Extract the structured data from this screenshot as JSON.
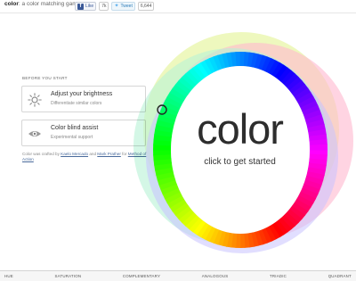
{
  "header": {
    "brand_name": "color",
    "brand_tagline": ": a color matching game",
    "fb_like": "Like",
    "fb_count": "7k",
    "tweet": "Tweet",
    "tweet_count": "6,644"
  },
  "intro": {
    "heading": "BEFORE YOU START",
    "brightness_title": "Adjust your brightness",
    "brightness_sub": "Differentiate similar colors",
    "colorblind_title": "Color blind assist",
    "colorblind_sub": "Experimental support",
    "credits_prefix": "Color was crafted by",
    "credit_one": "Kaelo Mercado",
    "credits_and": "and",
    "credit_two": "Mark Prather",
    "credits_for": "for",
    "credit_three": "Method of Action"
  },
  "wheel": {
    "title": "color",
    "subtitle": "click to get started",
    "accent": "#ffffff"
  },
  "modes": [
    "HUE",
    "SATURATION",
    "COMPLEMENTARY",
    "ANALOGOUS",
    "TRIADIC",
    "QUADRANT"
  ]
}
